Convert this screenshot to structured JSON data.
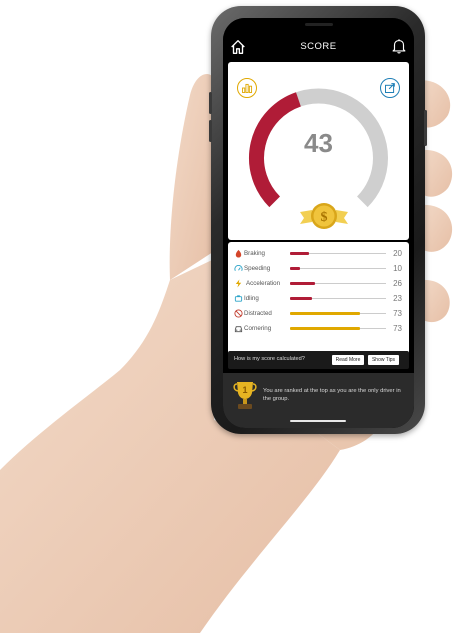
{
  "header": {
    "title": "SCORE"
  },
  "score": {
    "value": "43",
    "fraction": 0.43
  },
  "metrics": [
    {
      "label": "Braking",
      "value": "20",
      "fraction": 0.2,
      "color": "#b01c37",
      "icon": "brake-icon"
    },
    {
      "label": "Speeding",
      "value": "10",
      "fraction": 0.1,
      "color": "#b01c37",
      "icon": "speedometer-icon"
    },
    {
      "label": "Acceleration",
      "value": "26",
      "fraction": 0.26,
      "color": "#b01c37",
      "icon": "lightning-icon"
    },
    {
      "label": "Idling",
      "value": "23",
      "fraction": 0.23,
      "color": "#b01c37",
      "icon": "engine-icon"
    },
    {
      "label": "Distracted",
      "value": "73",
      "fraction": 0.73,
      "color": "#e0a800",
      "icon": "no-phone-icon"
    },
    {
      "label": "Cornering",
      "value": "73",
      "fraction": 0.73,
      "color": "#e0a800",
      "icon": "car-front-icon"
    }
  ],
  "info": {
    "question": "How is my score calculated?",
    "read_more": "Read More",
    "show_tips": "Show Tips"
  },
  "ranking": {
    "message": "You are ranked at the top as you are the only driver in the group."
  },
  "colors": {
    "accent_red": "#b01c37",
    "accent_gold": "#e0a800",
    "gauge_track": "#cfcfcf",
    "share_blue": "#1f7fb6"
  }
}
